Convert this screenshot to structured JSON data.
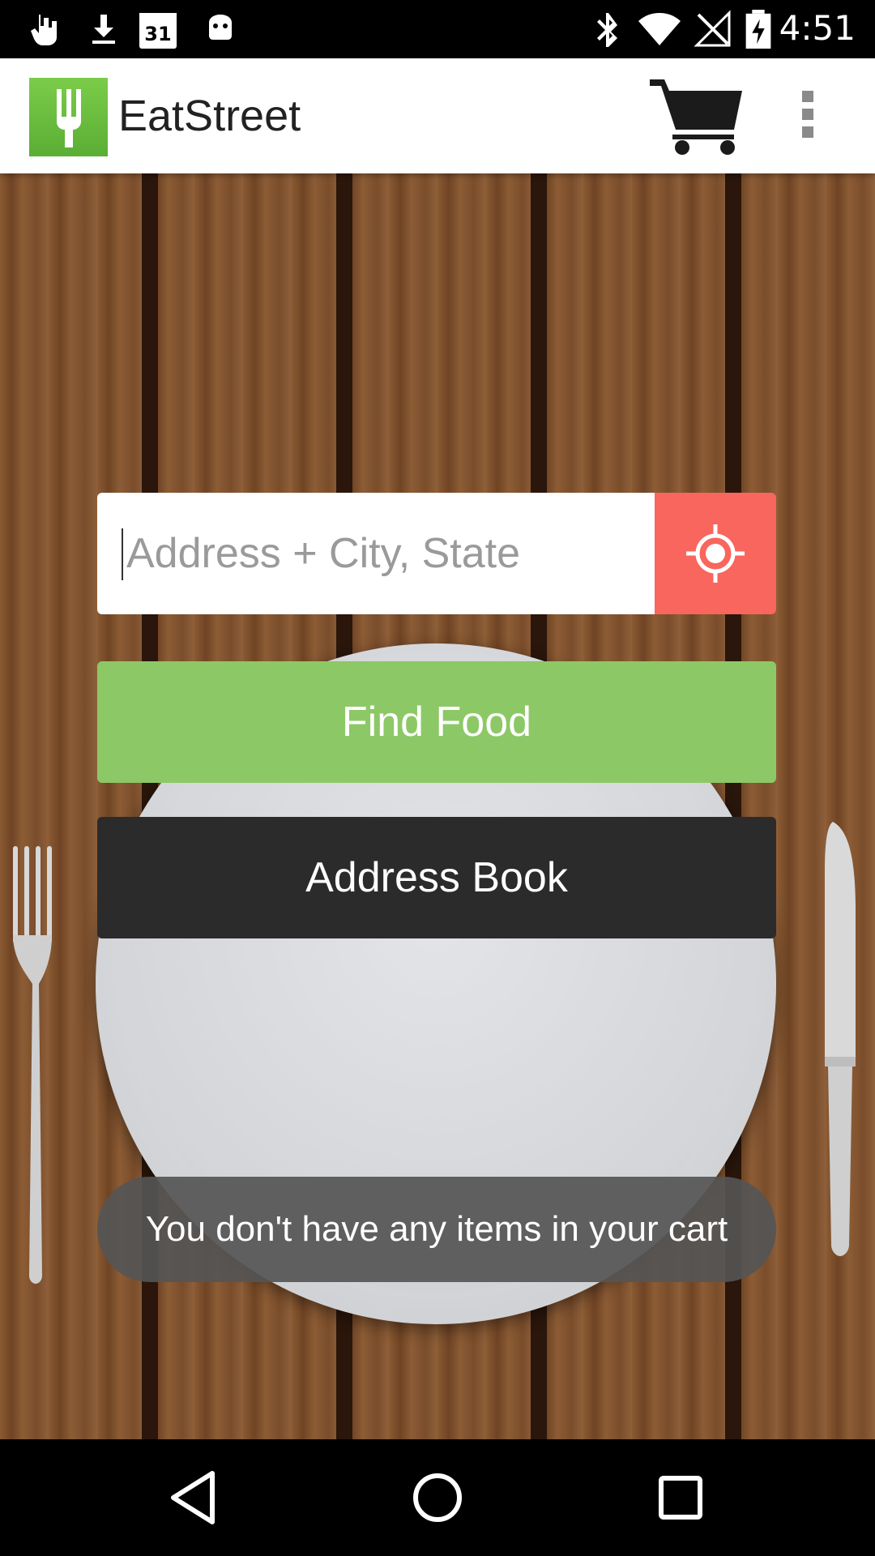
{
  "status_bar": {
    "time": "4:51",
    "calendar_day": "31",
    "left_icons": [
      "gesture-icon",
      "download-icon",
      "calendar-icon",
      "android-icon"
    ],
    "right_icons": [
      "bluetooth-icon",
      "wifi-icon",
      "no-signal-icon",
      "battery-charging-icon"
    ]
  },
  "app_bar": {
    "title": "EatStreet",
    "logo_icon": "fork-logo-icon",
    "actions": [
      "cart-icon",
      "overflow-menu-icon"
    ]
  },
  "search": {
    "address_placeholder": "Address + City, State",
    "address_value": "",
    "locate_icon": "locate-crosshair-icon"
  },
  "buttons": {
    "find_food": "Find Food",
    "address_book": "Address Book"
  },
  "toast": {
    "message": "You don't have any items in your cart"
  },
  "colors": {
    "brand_green": "#8dc866",
    "locate_red": "#f8665d",
    "dark_button": "#2b2b2c",
    "toast_bg": "#555555"
  },
  "nav_bar": {
    "buttons": [
      "back-icon",
      "home-icon",
      "recents-icon"
    ]
  }
}
